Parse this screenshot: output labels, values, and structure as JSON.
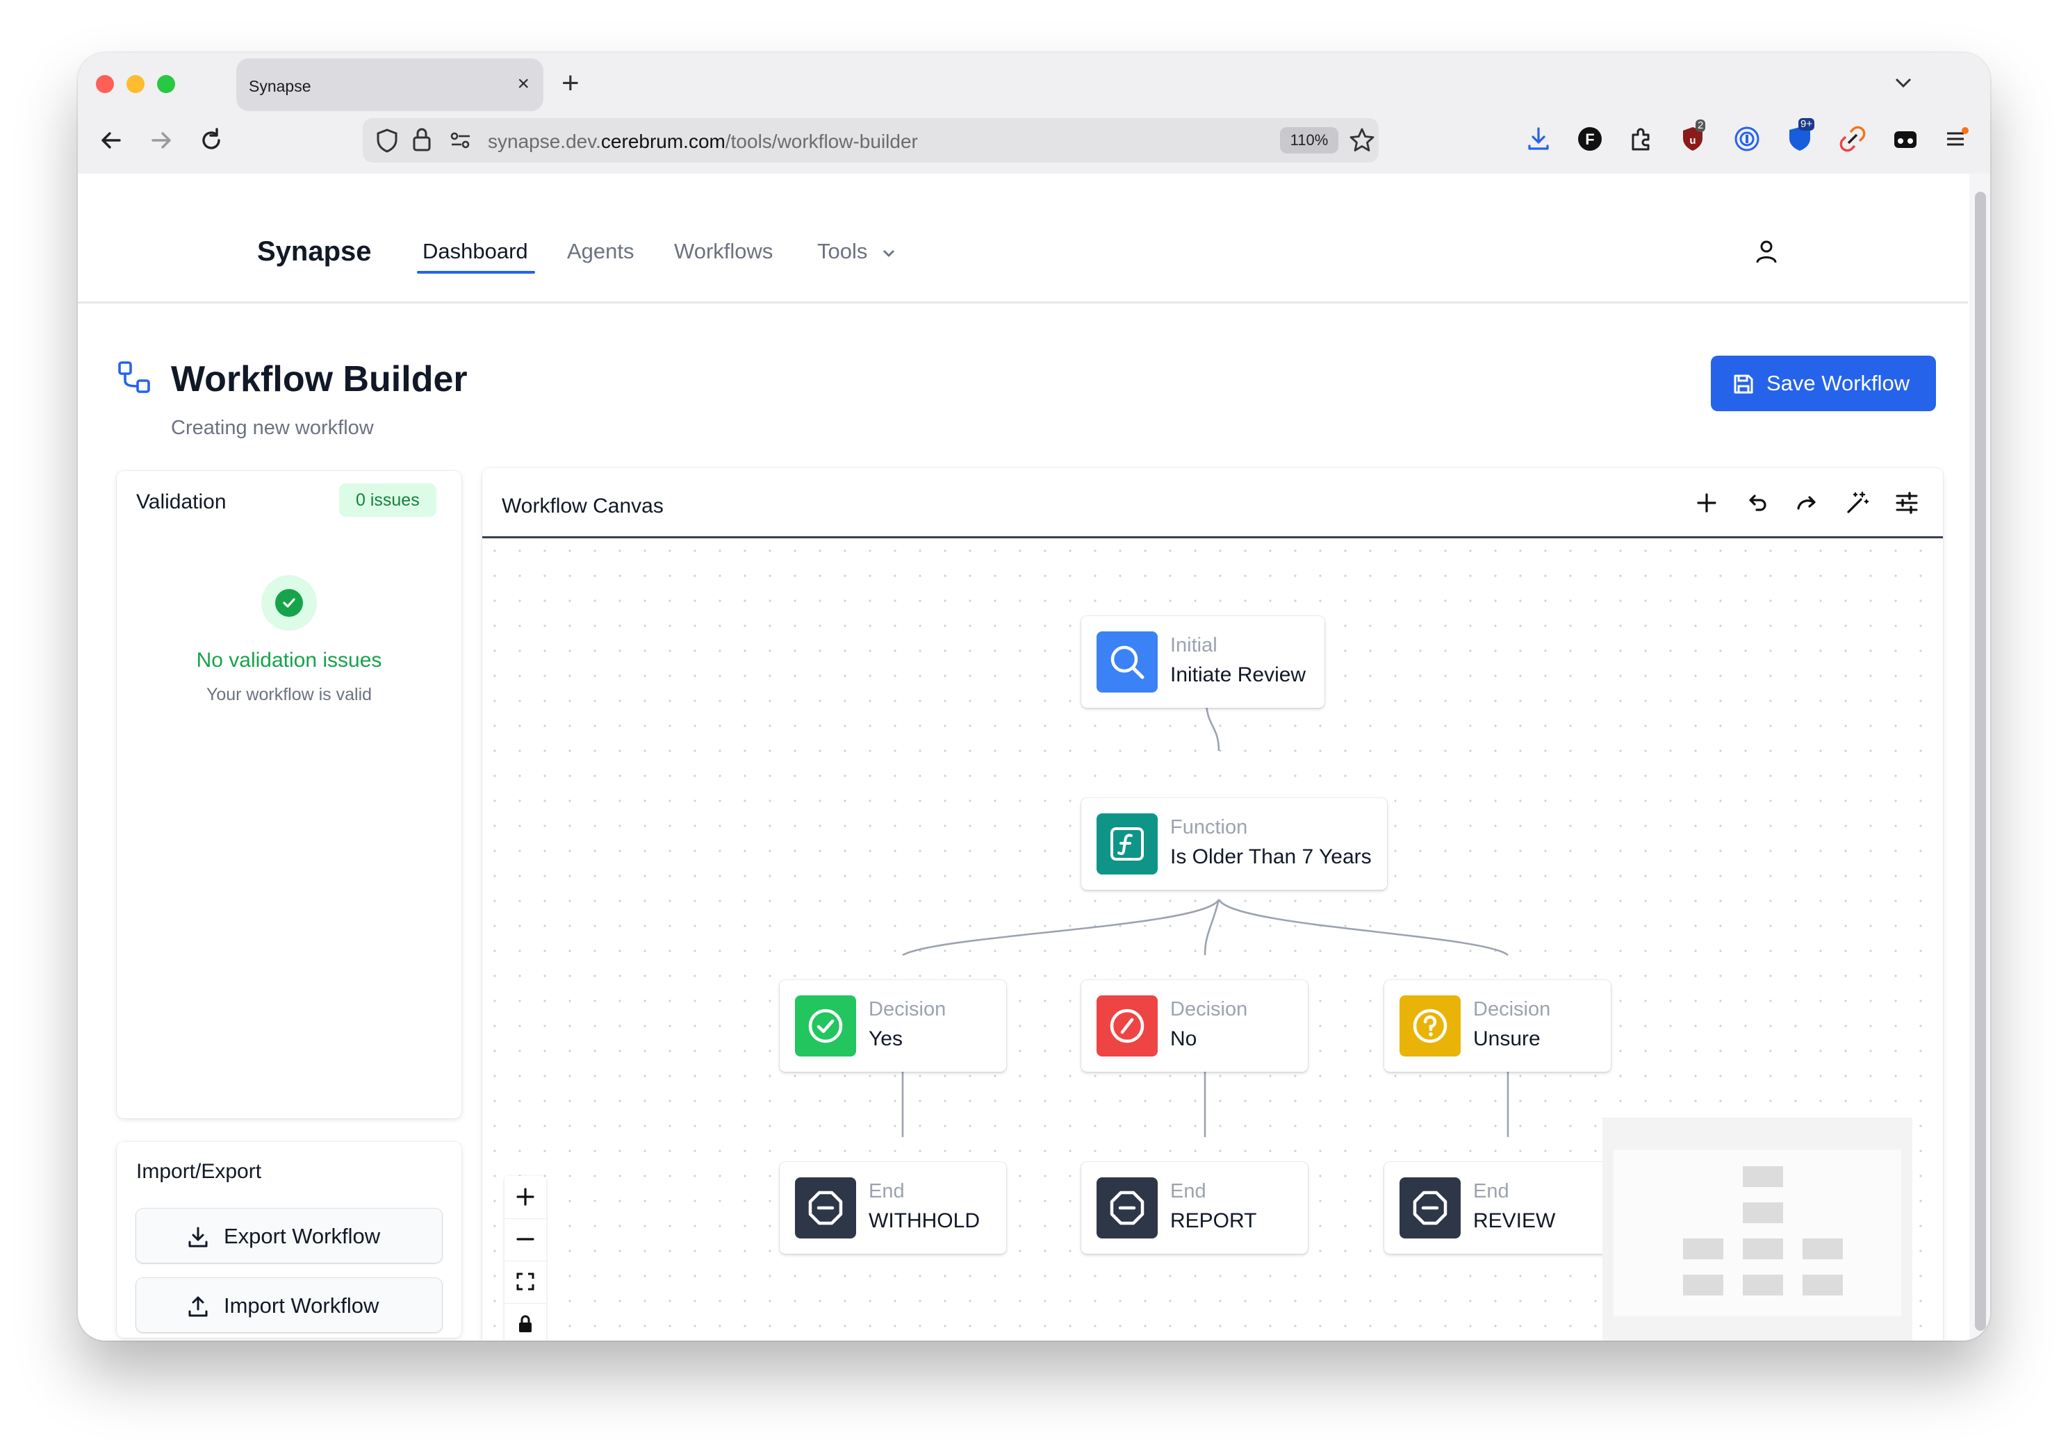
{
  "browser": {
    "tab_title": "Synapse",
    "tab_close": "×",
    "new_tab": "+",
    "url_domain": "synapse.dev.",
    "url_host": "cerebrum.com",
    "url_path": "/tools/workflow-builder",
    "zoom": "110%",
    "extension_badges": {
      "ublock": "2",
      "bitwarden": "9+"
    }
  },
  "nav": {
    "brand": "Synapse",
    "links": [
      {
        "label": "Dashboard",
        "active": true
      },
      {
        "label": "Agents",
        "active": false
      },
      {
        "label": "Workflows",
        "active": false
      },
      {
        "label": "Tools",
        "active": false
      }
    ]
  },
  "page": {
    "title": "Workflow Builder",
    "subtitle": "Creating new workflow",
    "save_button": "Save Workflow"
  },
  "validation": {
    "title": "Validation",
    "issues_badge": "0 issues",
    "status_title": "No validation issues",
    "status_sub": "Your workflow is valid"
  },
  "import_export": {
    "title": "Import/Export",
    "export_label": "Export Workflow",
    "import_label": "Import Workflow"
  },
  "canvas": {
    "title": "Workflow Canvas",
    "toolbar_icons": [
      "plus-icon",
      "undo-icon",
      "redo-icon",
      "magic-wand-icon",
      "sliders-icon"
    ],
    "zoom_controls": [
      "plus-icon",
      "minus-icon",
      "fit-view-icon",
      "lock-icon"
    ],
    "nodes": [
      {
        "id": "n1",
        "type": "Initial",
        "label": "Initiate Review",
        "icon": "search-icon",
        "color": "#3b82f6"
      },
      {
        "id": "n2",
        "type": "Function",
        "label": "Is Older Than 7 Years",
        "icon": "function-icon",
        "color": "#0f9488"
      },
      {
        "id": "n3",
        "type": "Decision",
        "label": "Yes",
        "icon": "check-circle-icon",
        "color": "#22c55e"
      },
      {
        "id": "n4",
        "type": "Decision",
        "label": "No",
        "icon": "slash-circle-icon",
        "color": "#ef4444"
      },
      {
        "id": "n5",
        "type": "Decision",
        "label": "Unsure",
        "icon": "question-circle-icon",
        "color": "#eab308"
      },
      {
        "id": "n6",
        "type": "End",
        "label": "WITHHOLD",
        "icon": "stop-icon",
        "color": "#2d3748"
      },
      {
        "id": "n7",
        "type": "End",
        "label": "REPORT",
        "icon": "stop-icon",
        "color": "#2d3748"
      },
      {
        "id": "n8",
        "type": "End",
        "label": "REVIEW",
        "icon": "stop-icon",
        "color": "#2d3748"
      }
    ]
  },
  "colors": {
    "accent": "#2563eb",
    "success": "#16a34a",
    "success_bg": "#dcfce7"
  }
}
